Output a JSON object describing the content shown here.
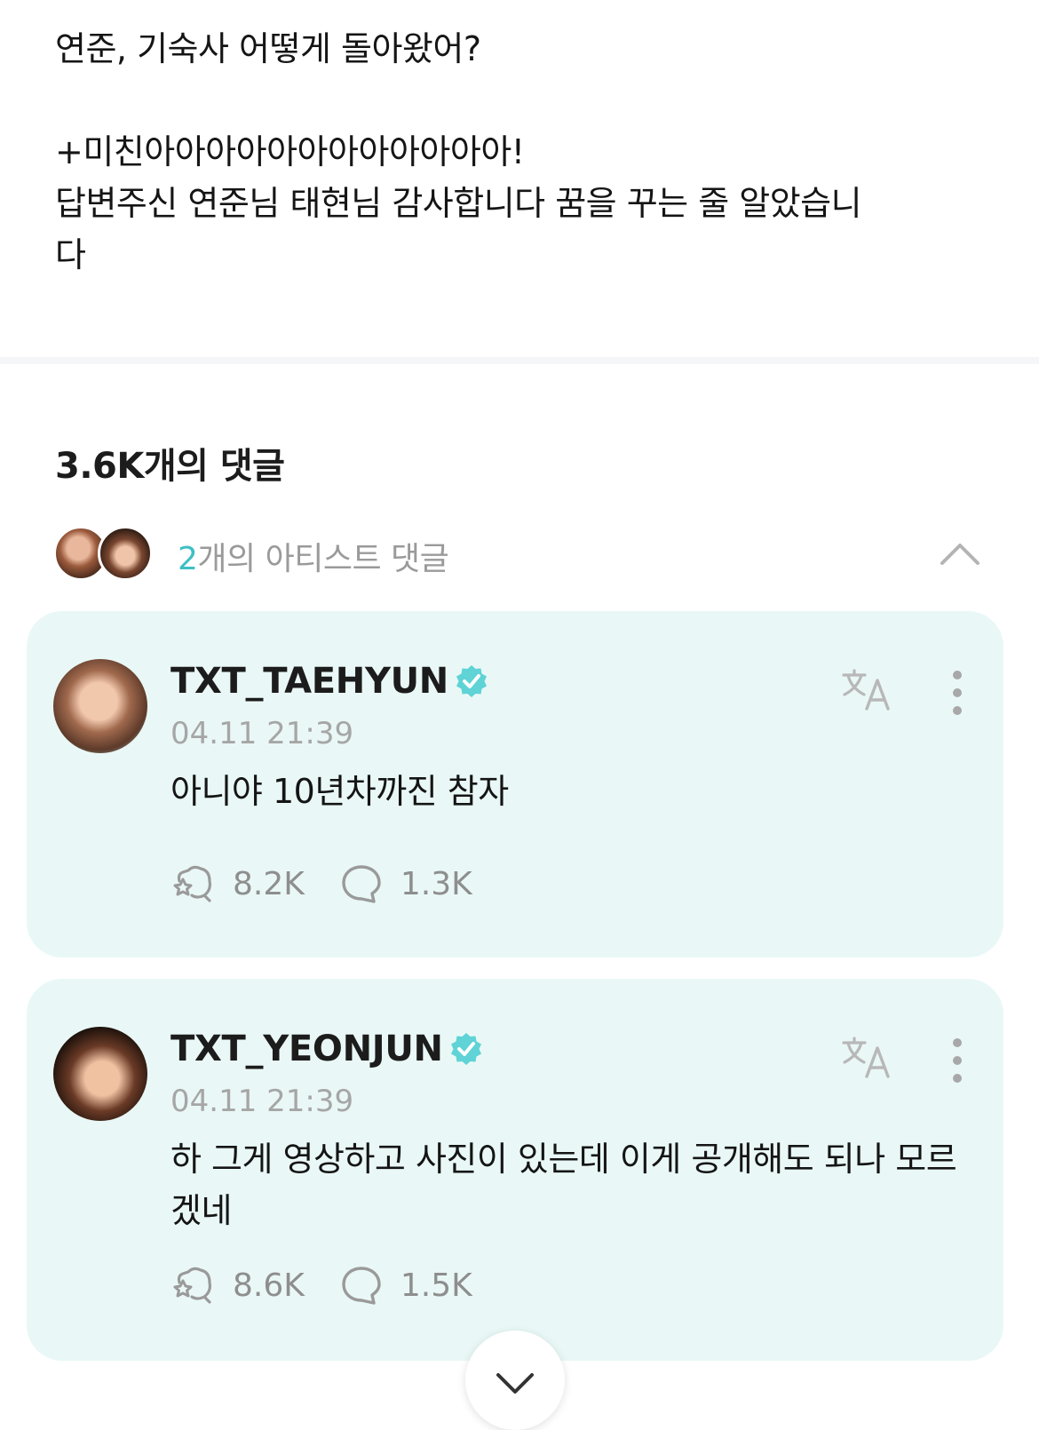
{
  "post": {
    "line1": "연준, 기숙사 어떻게 돌아왔어?",
    "line2": "+미친아아아아아아아아아아아아!",
    "line3": "답변주신 연준님 태현님 감사합니다 꿈을 꾸는 줄 알았습니",
    "line4": "다"
  },
  "comments_header": {
    "title": "3.6K개의 댓글"
  },
  "artist_comments": {
    "count": "2",
    "label": "개의 아티스트 댓글"
  },
  "comments": [
    {
      "username": "TXT_TAEHYUN",
      "timestamp": "04.11 21:39",
      "text": "아니야 10년차까진 참자",
      "likes": "8.2K",
      "replies": "1.3K"
    },
    {
      "username": "TXT_YEONJUN",
      "timestamp": "04.11 21:39",
      "text": "하 그게 영상하고 사진이 있는데 이게 공개해도 되나 모르겠네",
      "likes": "8.6K",
      "replies": "1.5K"
    }
  ],
  "colors": {
    "accent": "#3dbfc4",
    "card_bg": "#e9f8f6",
    "verified": "#5fd3d6"
  }
}
